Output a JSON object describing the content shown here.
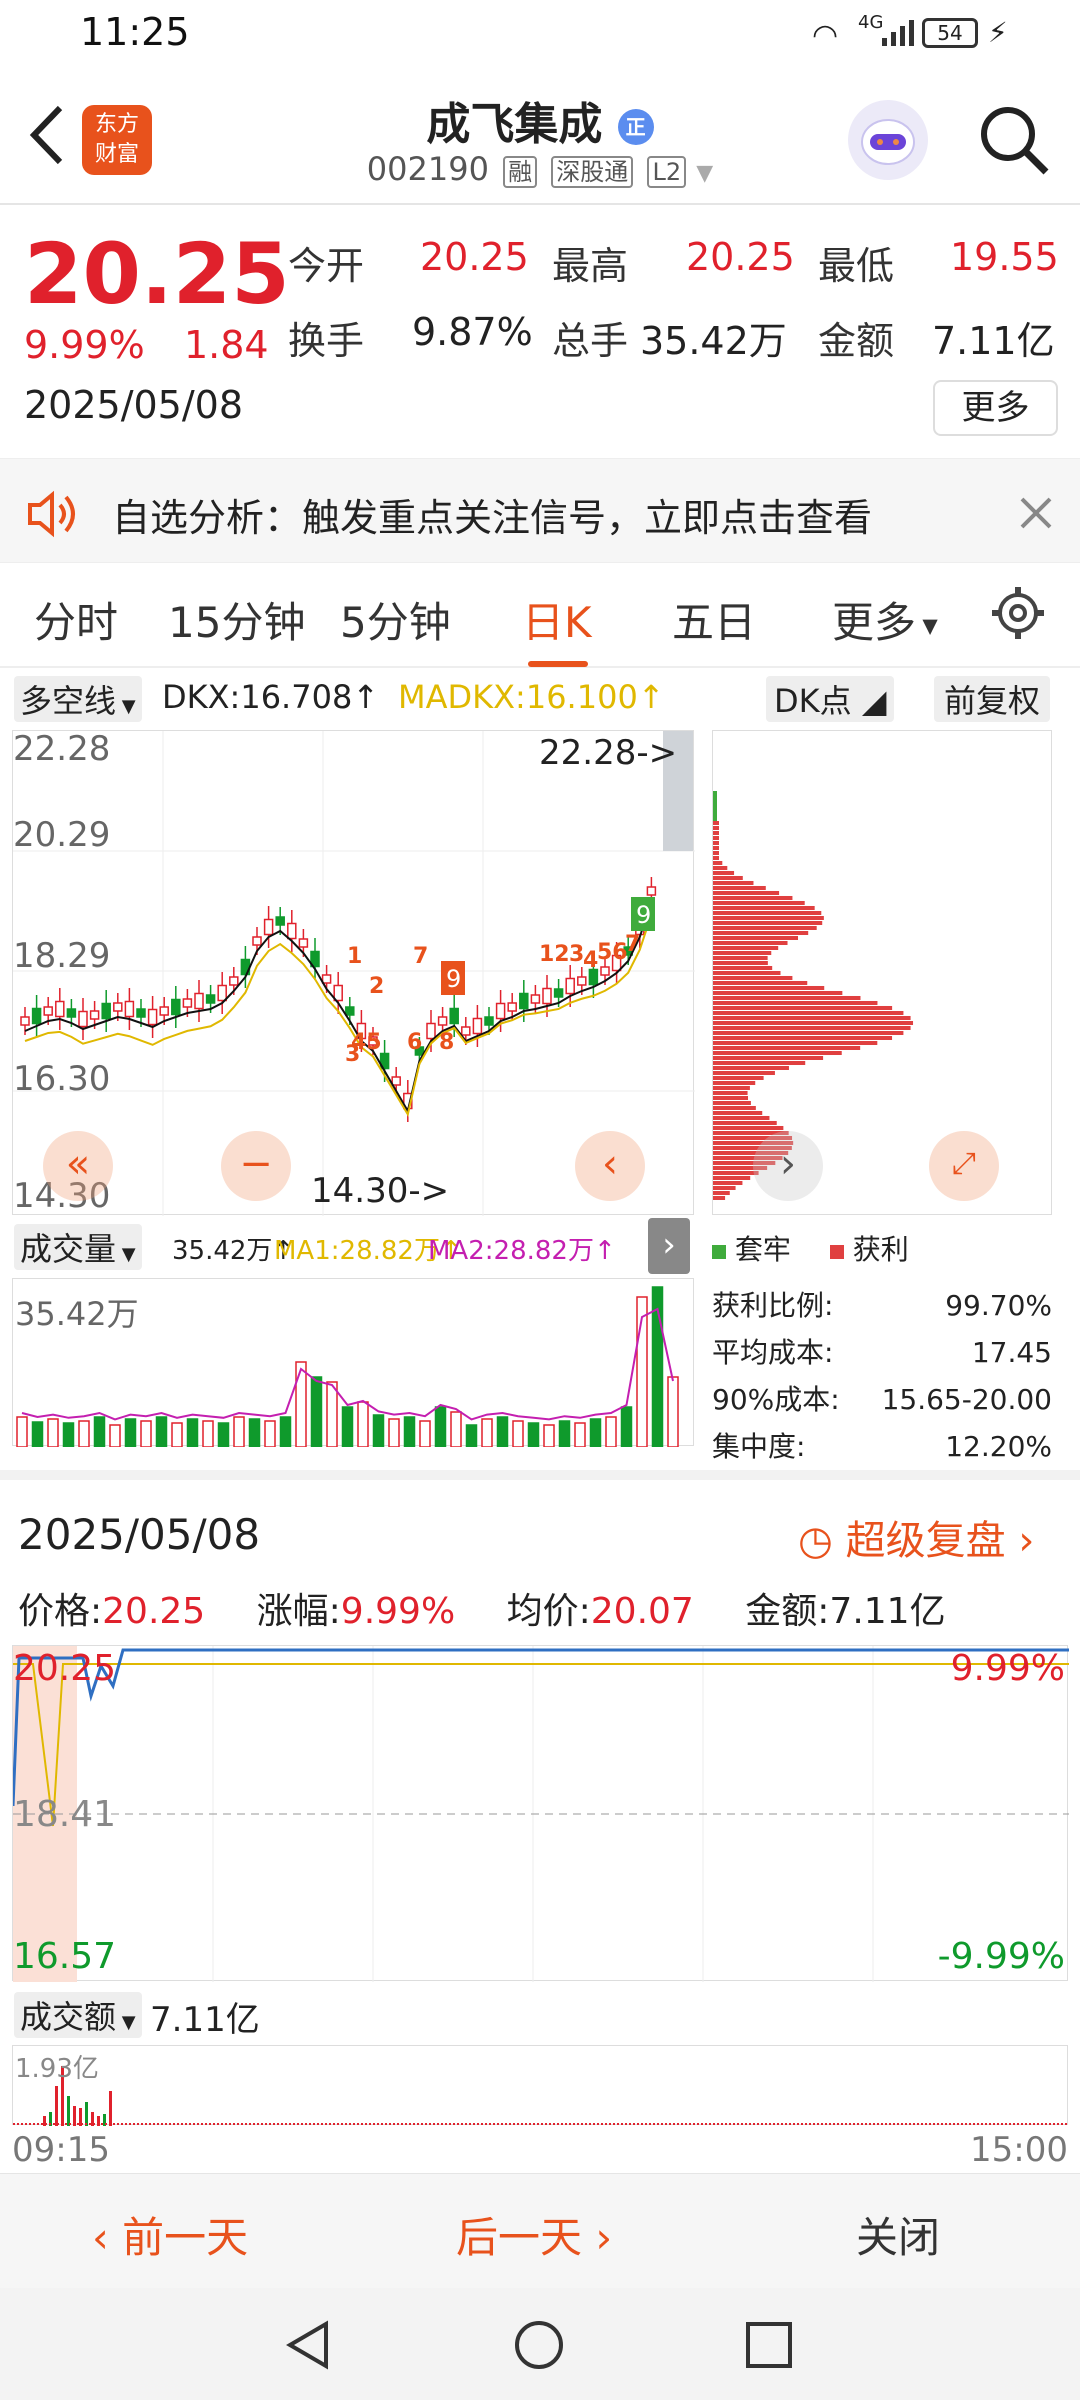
{
  "status": {
    "time": "11:25",
    "battery": "54",
    "network": "4G"
  },
  "header": {
    "logo_line1": "东方",
    "logo_line2": "财富",
    "title": "成飞集成",
    "title_badge": "正",
    "code": "002190",
    "tags": [
      "融",
      "深股通",
      "L2"
    ]
  },
  "quote": {
    "price": "20.25",
    "change_pct": "9.99%",
    "change": "1.84",
    "date": "2025/05/08",
    "open_label": "今开",
    "open": "20.25",
    "high_label": "最高",
    "high": "20.25",
    "low_label": "最低",
    "low": "19.55",
    "turnover_label": "换手",
    "turnover": "9.87%",
    "volume_label": "总手",
    "volume": "35.42万",
    "amount_label": "金额",
    "amount": "7.11亿",
    "more": "更多"
  },
  "notice": {
    "text": "自选分析：触发重点关注信号，立即点击查看"
  },
  "tabs": [
    {
      "label": "分时"
    },
    {
      "label": "15分钟"
    },
    {
      "label": "5分钟"
    },
    {
      "label": "日K"
    },
    {
      "label": "五日"
    },
    {
      "label": "更多"
    }
  ],
  "kline": {
    "indicator": "多空线",
    "dkx": "DKX:16.708↑",
    "madkx": "MADKX:16.100↑",
    "dk_point": "DK点",
    "adjust": "前复权",
    "y_labels": [
      "22.28",
      "20.29",
      "18.29",
      "16.30",
      "14.30"
    ],
    "max_mark": "22.28->",
    "min_mark": "14.30->",
    "colors": {
      "up": "#e0212c",
      "down": "#0f9a2c",
      "dkx": "#111111",
      "madkx": "#e0b800"
    }
  },
  "chips": {
    "legend_trapped": "套牢",
    "legend_profit": "获利",
    "rows": [
      {
        "label": "获利比例:",
        "value": "99.70%"
      },
      {
        "label": "平均成本:",
        "value": "17.45"
      },
      {
        "label": "90%成本:",
        "value": "15.65-20.00"
      },
      {
        "label": "集中度:",
        "value": "12.20%"
      }
    ]
  },
  "volume": {
    "label": "成交量",
    "value": "35.42万↑",
    "ma1": "MA1:28.82万↑",
    "ma2": "MA2:28.82万↑",
    "max": "35.42万"
  },
  "replay": {
    "date": "2025/05/08",
    "super": "超级复盘",
    "price_label": "价格:",
    "price": "20.25",
    "pct_label": "涨幅:",
    "pct": "9.99%",
    "avg_label": "均价:",
    "avg": "20.07",
    "amt_label": "金额:",
    "amt": "7.11亿",
    "y_top": "20.25",
    "y_mid": "18.41",
    "y_bot": "16.57",
    "pct_top": "9.99%",
    "pct_bot": "-9.99%",
    "amount_label": "成交额",
    "amount_value": "7.11亿",
    "amount_max": "1.93亿",
    "time_start": "09:15",
    "time_end": "15:00"
  },
  "bottom": {
    "prev": "前一天",
    "next": "后一天",
    "close": "关闭"
  }
}
